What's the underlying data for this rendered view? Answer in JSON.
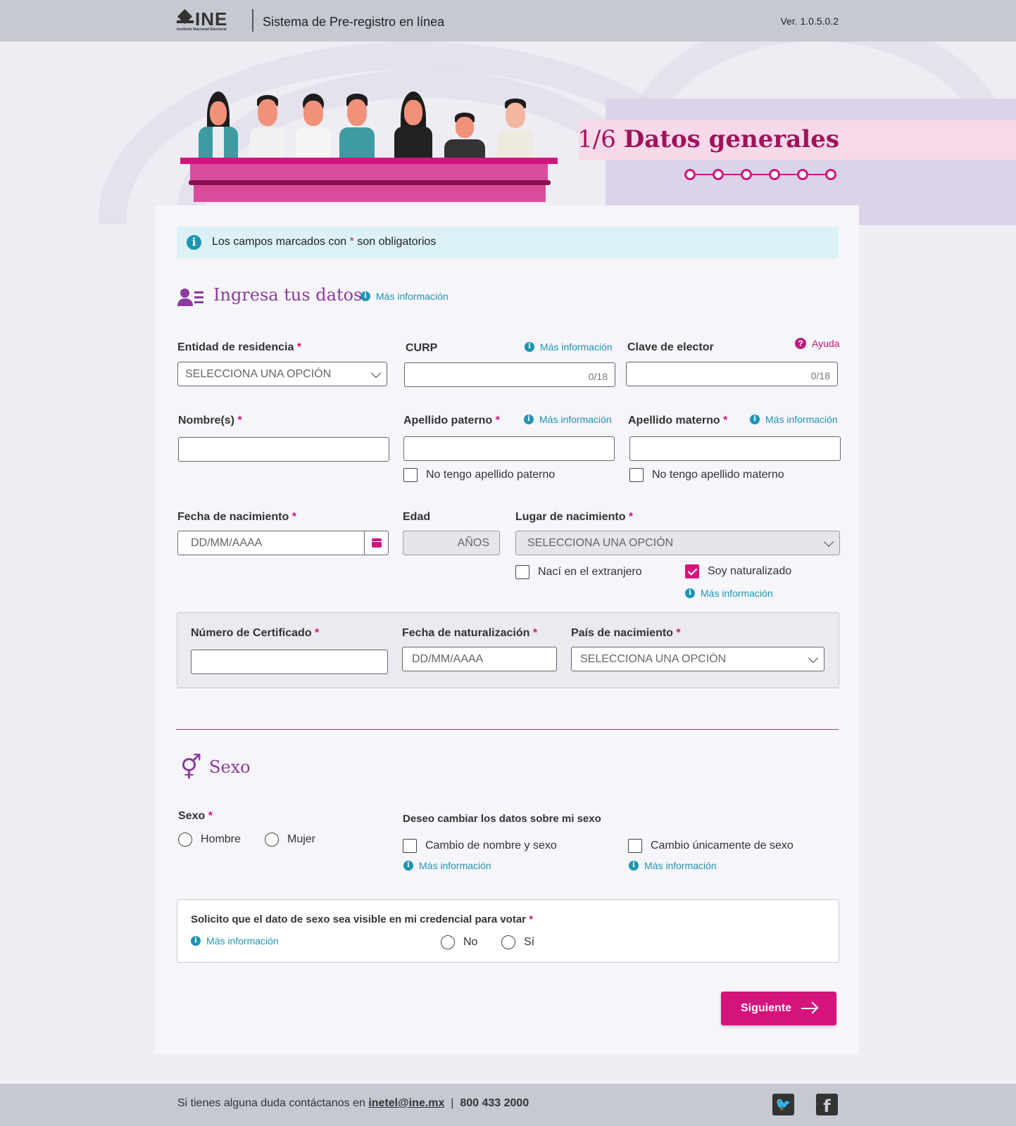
{
  "header": {
    "logo_text": "INE",
    "logo_subtitle": "Instituto Nacional Electoral",
    "app_title": "Sistema de Pre-registro en línea",
    "version": "Ver. 1.0.5.0.2"
  },
  "step": {
    "number": "1/6",
    "name": "Datos generales",
    "current": 1,
    "total": 6
  },
  "notice": {
    "prefix": "Los campos marcados con",
    "asterisk": "*",
    "suffix": "son obligatorios"
  },
  "section_data": {
    "title": "Ingresa tus datos",
    "more_info": "Más información"
  },
  "fields": {
    "entidad": {
      "label": "Entidad de residencia",
      "placeholder": "SELECCIONA UNA OPCIÓN"
    },
    "curp": {
      "label": "CURP",
      "more_info": "Más información",
      "counter": "0/18"
    },
    "clave": {
      "label": "Clave de elector",
      "help": "Ayuda",
      "counter": "0/18"
    },
    "nombre": {
      "label": "Nombre(s)"
    },
    "paterno": {
      "label": "Apellido paterno",
      "more_info": "Más información",
      "checkbox": "No tengo apellido paterno"
    },
    "materno": {
      "label": "Apellido materno",
      "more_info": "Más información",
      "checkbox": "No tengo apellido materno"
    },
    "fecha": {
      "label": "Fecha de nacimiento",
      "placeholder": "DD/MM/AAAA"
    },
    "edad": {
      "label": "Edad",
      "suffix": "AÑOS"
    },
    "lugar": {
      "label": "Lugar de nacimiento",
      "placeholder": "SELECCIONA UNA OPCIÓN",
      "extranjero": "Nací en el extranjero",
      "naturalizado": "Soy naturalizado",
      "more_info": "Más información"
    }
  },
  "naturalization": {
    "certificado": {
      "label": "Número de Certificado"
    },
    "fecha": {
      "label": "Fecha de naturalización",
      "placeholder": "DD/MM/AAAA"
    },
    "pais": {
      "label": "País de nacimiento",
      "placeholder": "SELECCIONA UNA OPCIÓN"
    }
  },
  "section_sex": {
    "title": "Sexo",
    "label": "Sexo",
    "options": [
      "Hombre",
      "Mujer"
    ],
    "change_label": "Deseo cambiar los datos sobre mi sexo",
    "change_name_sex": "Cambio de nombre y sexo",
    "change_sex_only": "Cambio únicamente de sexo",
    "more_info": "Más información"
  },
  "visibility": {
    "label": "Solicito que el dato de sexo sea visible en mi credencial para votar",
    "more_info": "Más información",
    "no": "No",
    "yes": "Sí"
  },
  "actions": {
    "next": "Siguiente"
  },
  "footer": {
    "text": "Si tienes alguna duda contáctanos en",
    "email": "inetel@ine.mx",
    "separator": "|",
    "phone": "800 433 2000"
  },
  "colors": {
    "accent": "#d4147c",
    "section": "#8c3a9e",
    "info": "#1d95b4"
  },
  "icons": [
    "user-list-icon",
    "info-icon",
    "help-icon",
    "calendar-icon",
    "gender-icon",
    "arrow-right-icon",
    "twitter-icon",
    "facebook-icon"
  ]
}
